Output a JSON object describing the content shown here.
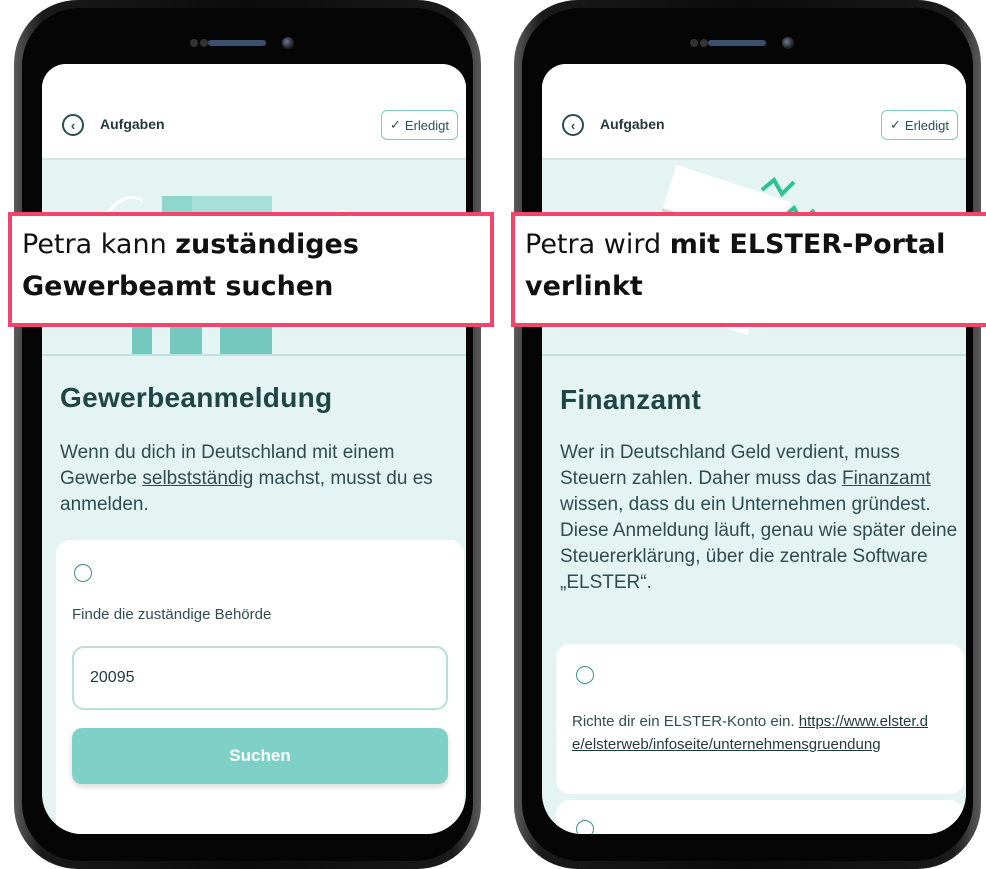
{
  "left_phone": {
    "header": {
      "back_label": "Aufgaben",
      "done_label": "Erledigt"
    },
    "title": "Gewerbeanmeldung",
    "body_pre": "Wenn du dich in Deutschland mit einem Gewerbe ",
    "body_link": "selbstständig",
    "body_post": " machst, musst du es anmelden.",
    "card": {
      "label": "Finde die zuständige Behörde",
      "input_value": "20095",
      "button_label": "Suchen"
    },
    "callout": {
      "prefix": "Petra kann ",
      "bold": "zuständiges Gewerbeamt suchen"
    }
  },
  "right_phone": {
    "header": {
      "back_label": "Aufgaben",
      "done_label": "Erledigt"
    },
    "title": "Finanzamt",
    "body_pre": "Wer in Deutschland Geld verdient, muss Steuern zahlen. Daher muss das ",
    "body_link": "Finanzamt",
    "body_post": " wissen, dass du ein Unternehmen gründest. Diese Anmeldung läuft, genau wie später deine Steuererklärung, über die zentrale Software „ELSTER“.",
    "card": {
      "task_text": "Richte dir ein ELSTER-Konto ein. ",
      "task_link": "https://www.elster.de/elsterweb/infoseite/unternehmensgruendung"
    },
    "callout": {
      "prefix": "Petra wird ",
      "bold_line1": "mit ELSTER-Portal",
      "bold_line2": "verlinkt"
    }
  },
  "colors": {
    "accent": "#7fd0c6",
    "screen_bg": "#e3f4f2",
    "callout_border": "#f1456b",
    "title_text": "#1f4547"
  },
  "icons": [
    "back-arrow-icon",
    "checkmark-icon",
    "radio-icon"
  ]
}
